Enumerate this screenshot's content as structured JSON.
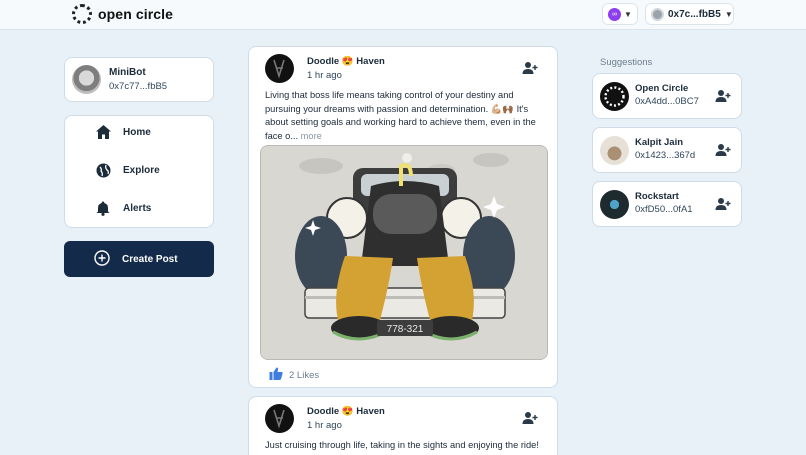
{
  "app": {
    "name": "open circle"
  },
  "header": {
    "network_icon": "polygon-icon",
    "wallet_address": "0x7c...fbB5"
  },
  "profile": {
    "name": "MiniBot",
    "address": "0x7c77...fbB5"
  },
  "nav": {
    "items": [
      {
        "label": "Home",
        "icon": "home-icon"
      },
      {
        "label": "Explore",
        "icon": "globe-icon"
      },
      {
        "label": "Alerts",
        "icon": "bell-icon"
      }
    ]
  },
  "create_post": {
    "label": "Create Post"
  },
  "posts": [
    {
      "author": "Doodle 😍 Haven",
      "time": "1 hr ago",
      "text": "Living that boss life means taking control of your destiny and pursuing your dreams with passion and determination. 💪🏼🙌🏾 It's about setting goals and working hard to achieve them, even in the face o...",
      "more": "more",
      "likes": "2 Likes",
      "image_plate": "778-321"
    },
    {
      "author": "Doodle 😍 Haven",
      "time": "1 hr ago",
      "text": "Just cruising through life, taking in the sights and enjoying the ride!"
    }
  ],
  "suggestions": {
    "title": "Suggestions",
    "items": [
      {
        "name": "Open Circle",
        "address": "0xA4dd...0BC7"
      },
      {
        "name": "Kalpit Jain",
        "address": "0x1423...367d"
      },
      {
        "name": "Rockstart",
        "address": "0xfD50...0fA1"
      }
    ]
  },
  "colors": {
    "accent": "#132a4a",
    "background": "#e9f1f8",
    "network": "#8d3ff0"
  }
}
